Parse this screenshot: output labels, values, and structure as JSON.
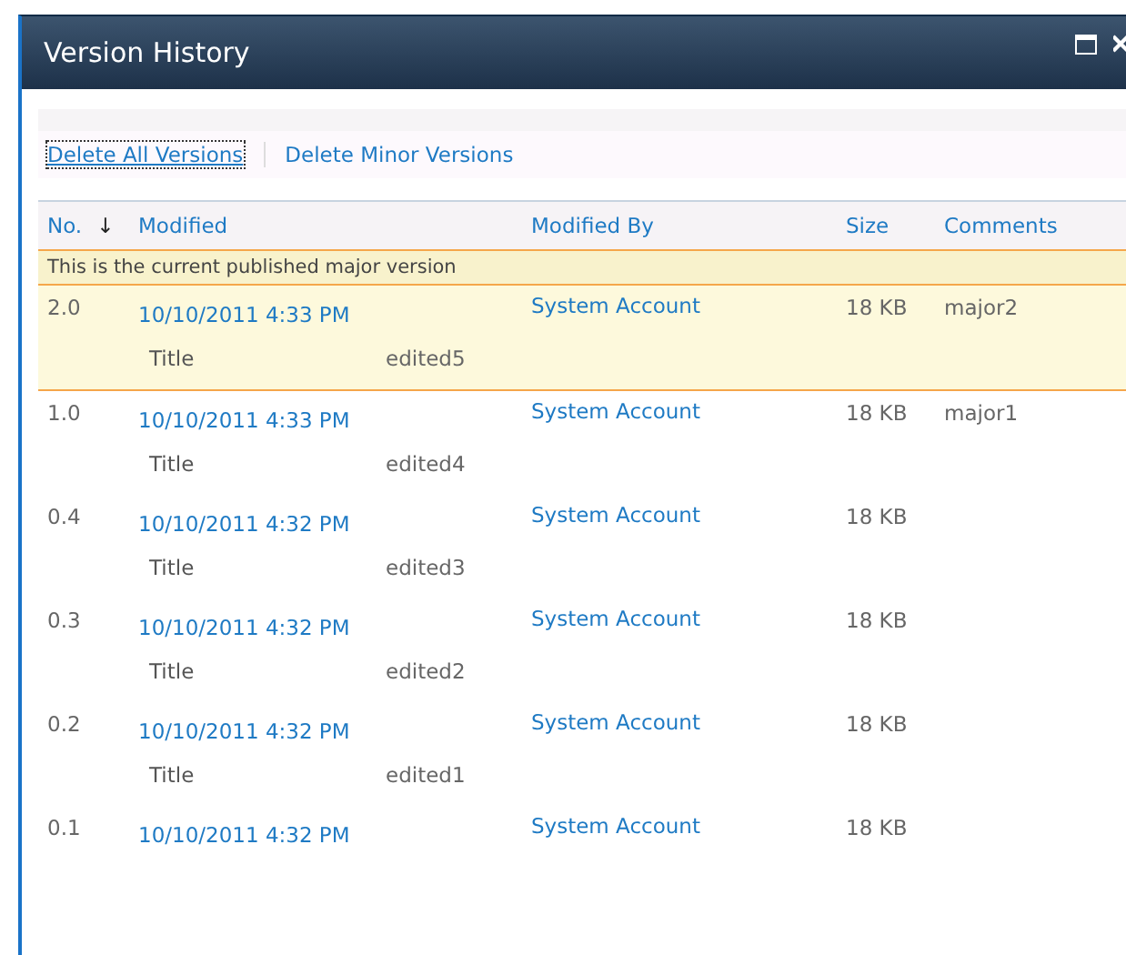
{
  "window": {
    "title": "Version History"
  },
  "actions": [
    "Delete All Versions",
    "Delete Minor Versions"
  ],
  "table": {
    "columns": [
      {
        "label": "No.",
        "sort_arrow": "↓"
      },
      {
        "label": "Modified"
      },
      {
        "label": "Modified By"
      },
      {
        "label": "Size"
      },
      {
        "label": "Comments"
      }
    ],
    "current_banner": "This is the current published major version",
    "rows": [
      {
        "no": "2.0",
        "modified": "10/10/2011 4:33 PM",
        "modified_by": "System Account",
        "size": "18 KB",
        "comments": "major2",
        "current": true,
        "changes": [
          {
            "field": "Title",
            "value": "edited5"
          }
        ]
      },
      {
        "no": "1.0",
        "modified": "10/10/2011 4:33 PM",
        "modified_by": "System Account",
        "size": "18 KB",
        "comments": "major1",
        "current": false,
        "changes": [
          {
            "field": "Title",
            "value": "edited4"
          }
        ]
      },
      {
        "no": "0.4",
        "modified": "10/10/2011 4:32 PM",
        "modified_by": "System Account",
        "size": "18 KB",
        "current": false,
        "changes": [
          {
            "field": "Title",
            "value": "edited3"
          }
        ]
      },
      {
        "no": "0.3",
        "modified": "10/10/2011 4:32 PM",
        "modified_by": "System Account",
        "size": "18 KB",
        "current": false,
        "changes": [
          {
            "field": "Title",
            "value": "edited2"
          }
        ]
      },
      {
        "no": "0.2",
        "modified": "10/10/2011 4:32 PM",
        "modified_by": "System Account",
        "size": "18 KB",
        "current": false,
        "changes": [
          {
            "field": "Title",
            "value": "edited1"
          }
        ]
      },
      {
        "no": "0.1",
        "modified": "10/10/2011 4:32 PM",
        "modified_by": "System Account",
        "size": "18 KB",
        "current": false
      }
    ]
  }
}
